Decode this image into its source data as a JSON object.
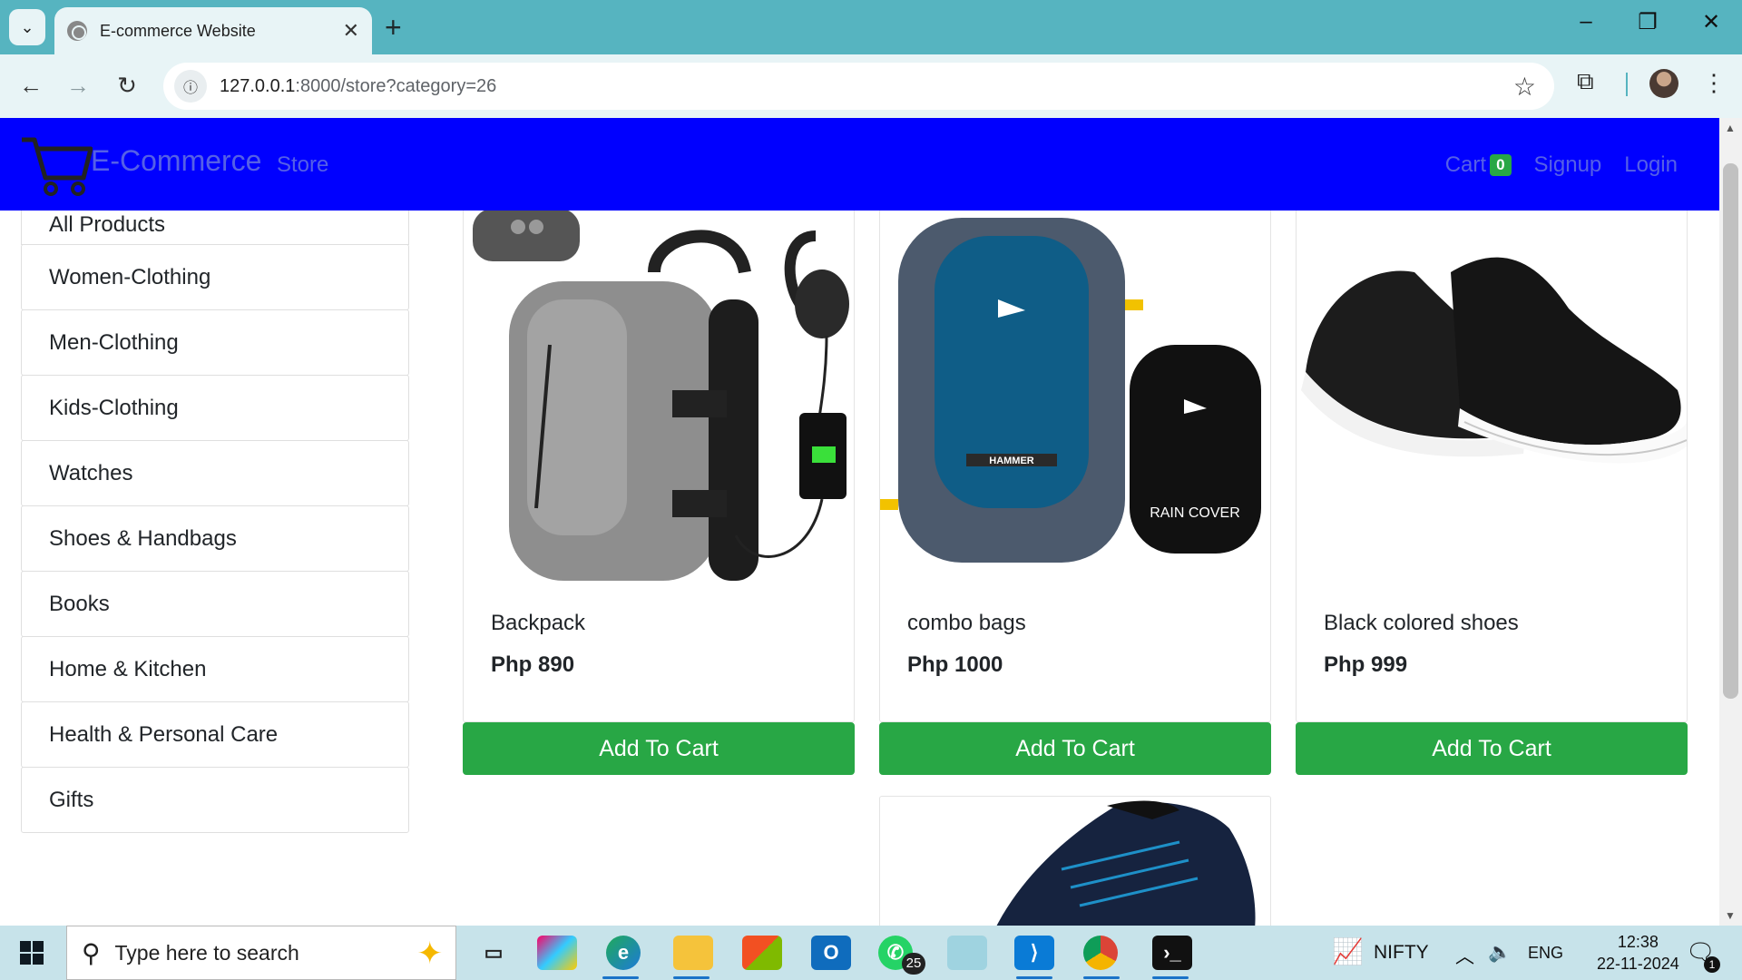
{
  "browser": {
    "tab_title": "E-commerce Website",
    "new_tab_glyph": "+",
    "url_host": "127.0.0.1",
    "url_rest": ":8000/store?category=26",
    "window_controls": [
      "–",
      "❐",
      "✕"
    ]
  },
  "navbar": {
    "brand": "E-Commerce",
    "store_link": "Store",
    "cart_label": "Cart",
    "cart_count": "0",
    "signup": "Signup",
    "login": "Login",
    "bg_color": "#0000ff",
    "link_color": "#5560e6"
  },
  "sidebar": {
    "categories": [
      "All Products",
      "Women-Clothing",
      "Men-Clothing",
      "Kids-Clothing",
      "Watches",
      "Shoes & Handbags",
      "Books",
      "Home & Kitchen",
      "Health & Personal Care",
      "Gifts"
    ]
  },
  "products": [
    {
      "name": "Backpack",
      "price": "Php 890",
      "button": "Add To Cart"
    },
    {
      "name": "combo bags",
      "price": "Php 1000",
      "button": "Add To Cart"
    },
    {
      "name": "Black colored shoes",
      "price": "Php 999",
      "button": "Add To Cart"
    }
  ],
  "product_images": {
    "backpack": "backpack with headphones and phone",
    "combo_bags_rain_cover": "RAIN COVER",
    "combo_bags_brand": "HAMMER"
  },
  "accent_color": "#28a745",
  "taskbar": {
    "search_placeholder": "Type here to search",
    "whatsapp_badge": "25",
    "nifty_label": "NIFTY",
    "language": "ENG",
    "time": "12:38",
    "date": "22-11-2024",
    "notification_count": "1"
  }
}
